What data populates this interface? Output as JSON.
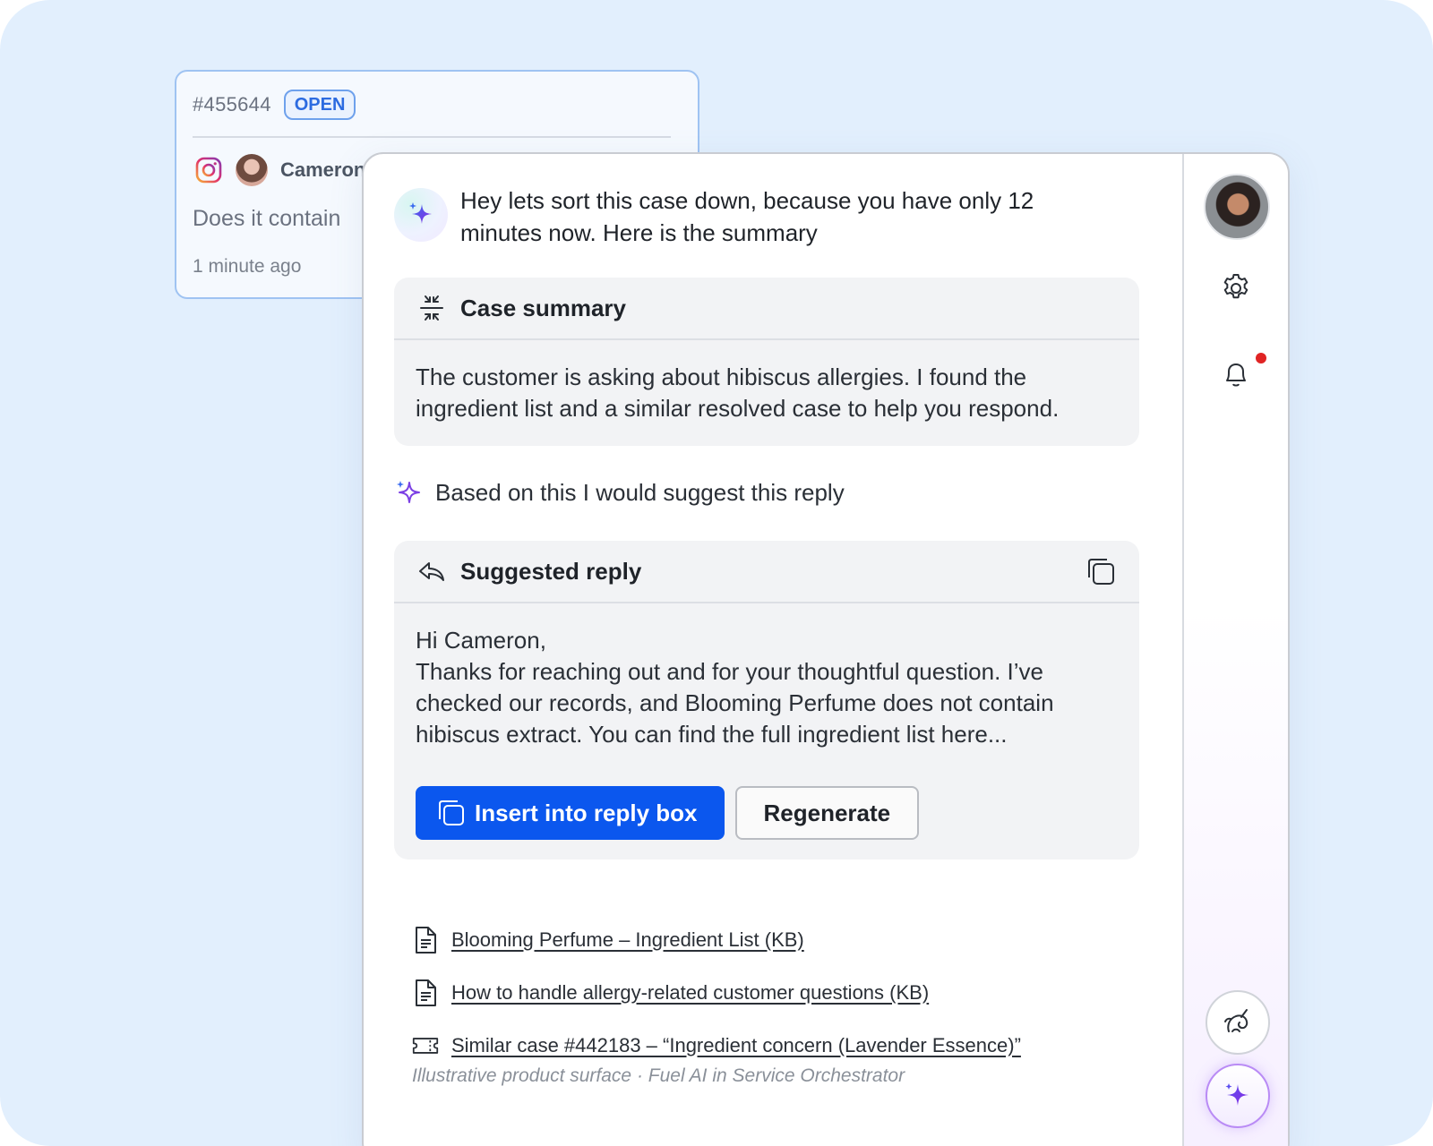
{
  "ticket": {
    "id": "#455644",
    "status": "OPEN",
    "channel_icon": "instagram-icon",
    "customer_name": "Cameron",
    "message_preview": "Does it contain",
    "time": "1 minute ago"
  },
  "assistant": {
    "greeting": "Hey lets sort this case down, because you have only 12 minutes now. Here is the summary",
    "summary": {
      "title": "Case summary",
      "body": "The customer is asking about hibiscus allergies. I found the ingredient list and a similar resolved case to help you respond."
    },
    "suggest_intro": "Based on this I would suggest this reply",
    "reply": {
      "title": "Suggested reply",
      "line1": "Hi Cameron,",
      "body": "Thanks for reaching out and for your thoughtful question. I’ve checked our records, and Blooming Perfume does not contain hibiscus extract. You can find the full ingredient list here...",
      "insert_label": "Insert into reply box",
      "regenerate_label": "Regenerate"
    },
    "links": [
      {
        "label": "Blooming Perfume – Ingredient List (KB)",
        "icon": "document-icon"
      },
      {
        "label": "How to handle allergy-related customer questions (KB)",
        "icon": "document-icon"
      },
      {
        "label": "Similar case #442183 – “Ingredient concern (Lavender Essence)”",
        "icon": "ticket-icon"
      }
    ],
    "footer": "Illustrative product surface · Fuel AI in Service Orchestrator"
  },
  "colors": {
    "background": "#e2effd",
    "accent": "#0b57ee",
    "ai_purple": "#7b3fe4",
    "open_badge": "#2c6be0",
    "notification": "#e02424"
  }
}
